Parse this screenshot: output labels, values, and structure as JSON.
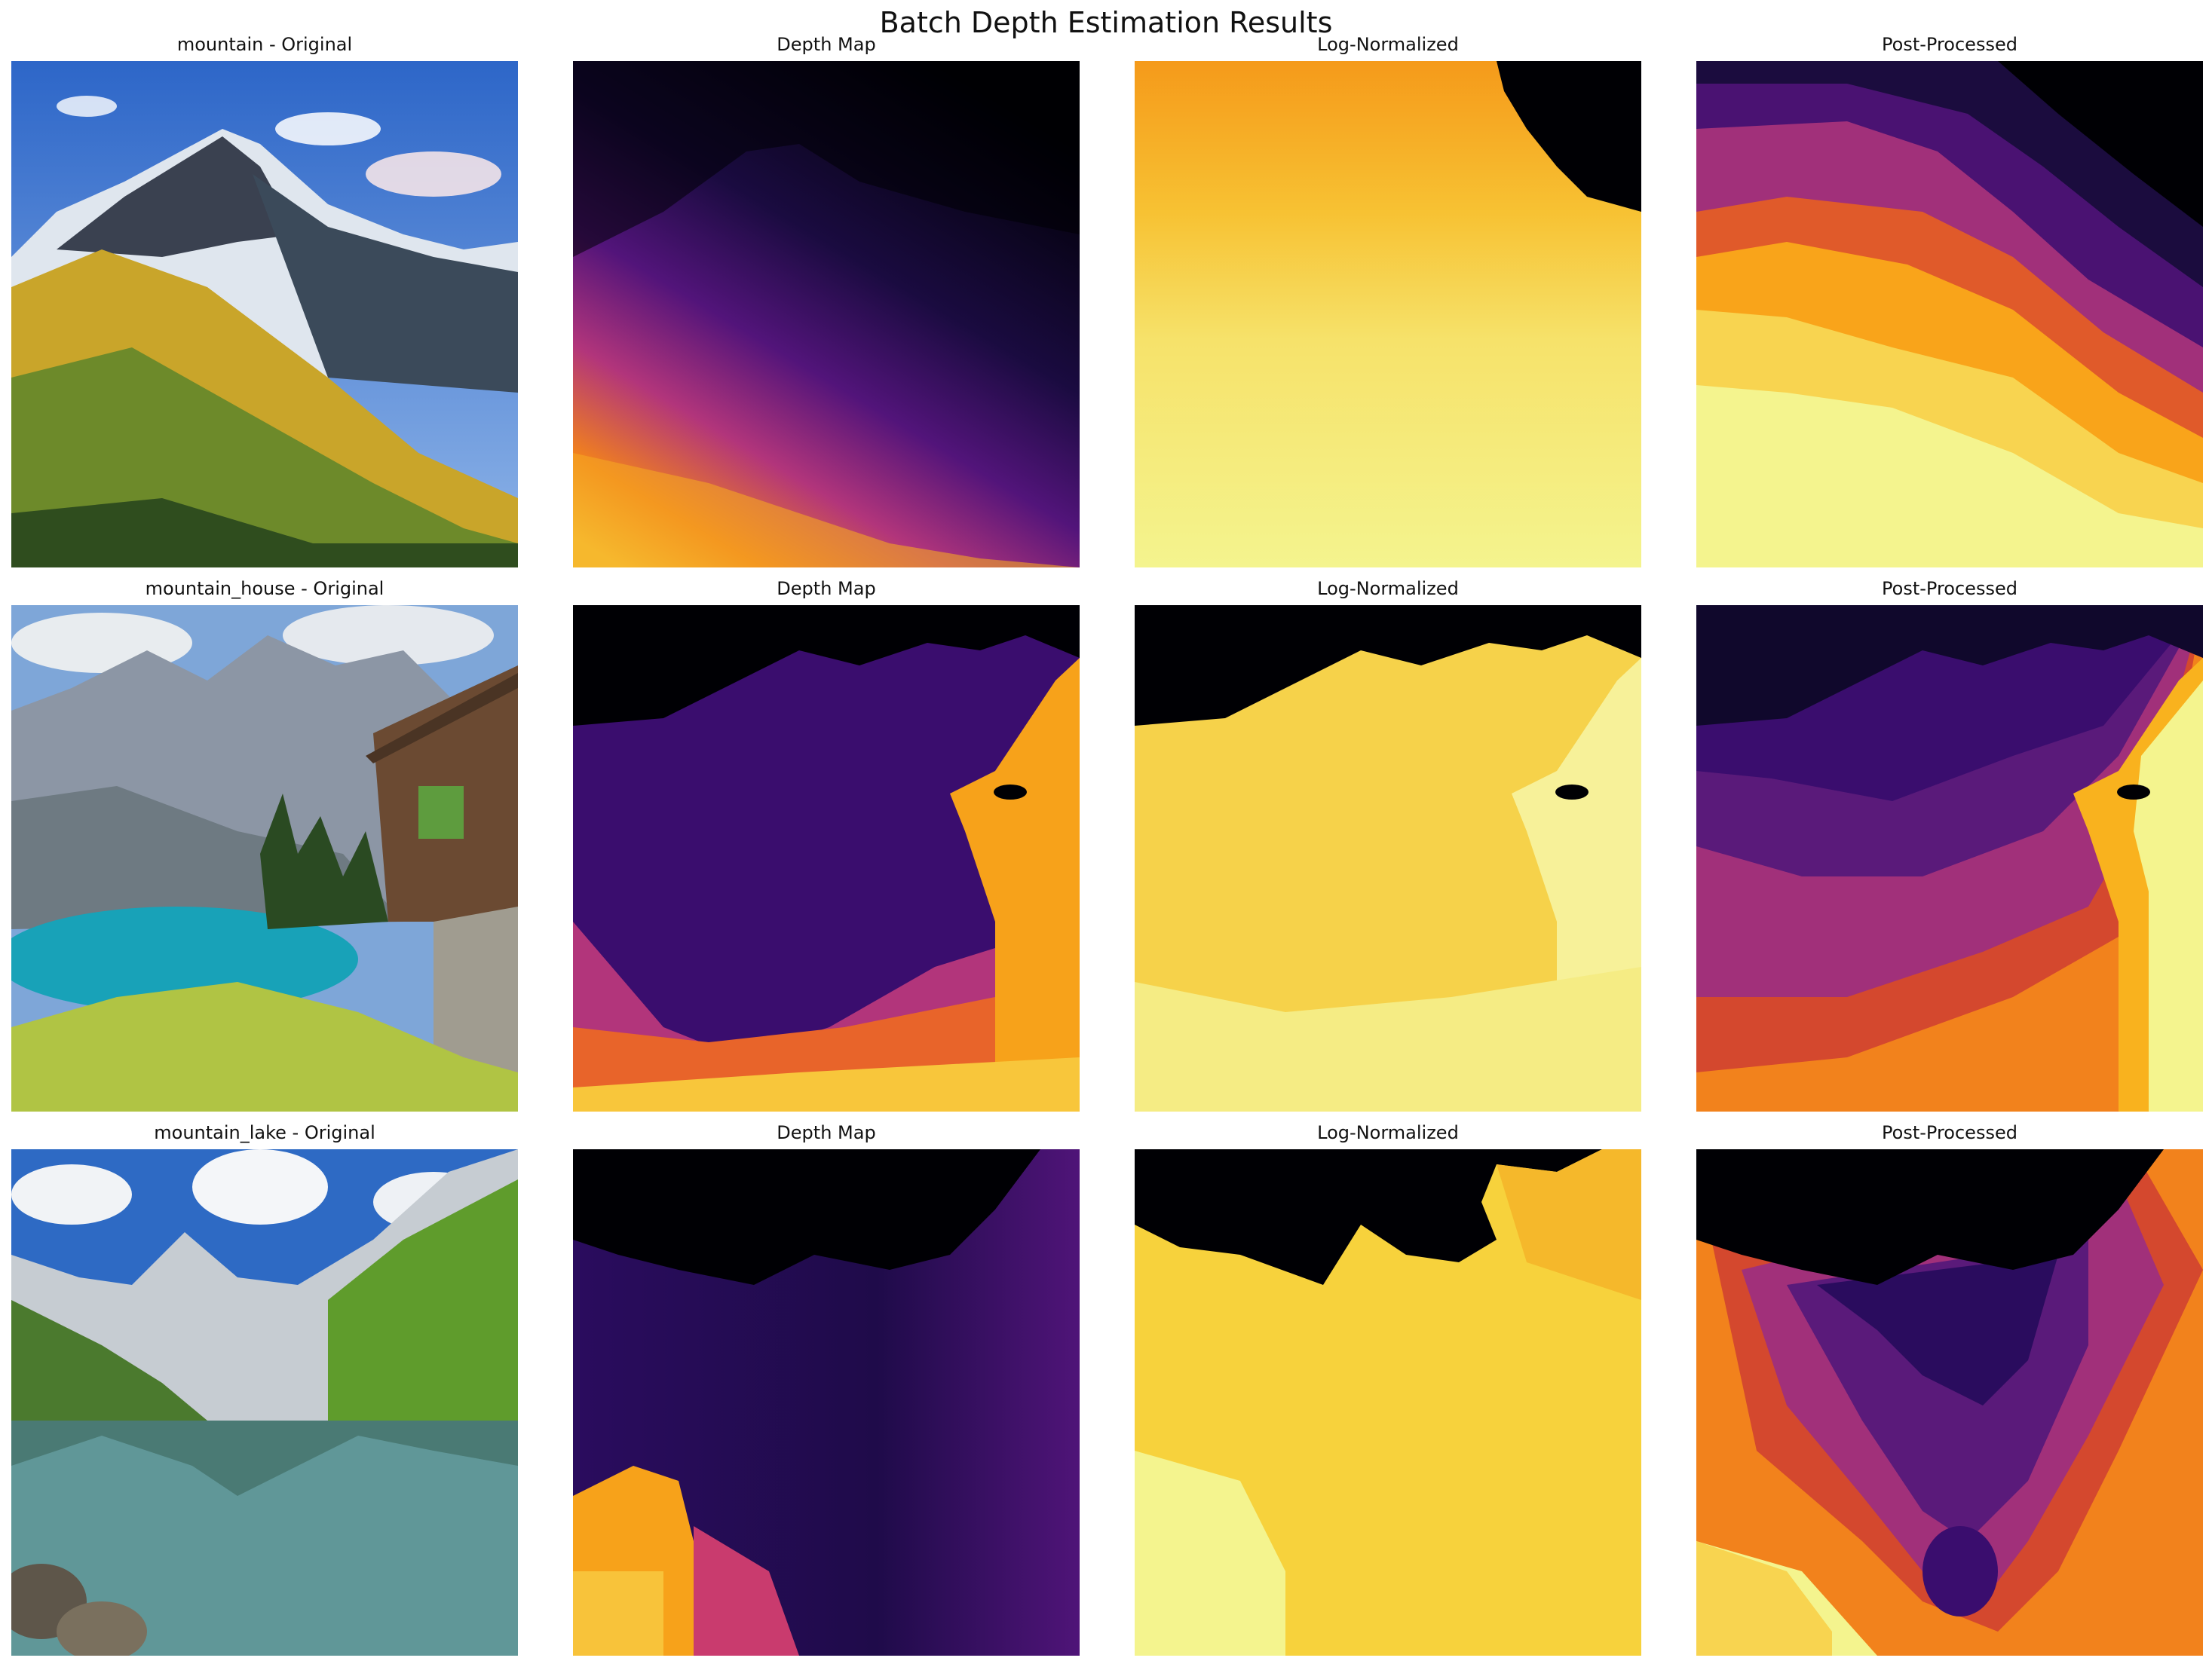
{
  "figure": {
    "title": "Batch Depth Estimation Results"
  },
  "rows": [
    {
      "name": "mountain",
      "titles": [
        "mountain - Original",
        "Depth Map",
        "Log-Normalized",
        "Post-Processed"
      ]
    },
    {
      "name": "mountain_house",
      "titles": [
        "mountain_house - Original",
        "Depth Map",
        "Log-Normalized",
        "Post-Processed"
      ]
    },
    {
      "name": "mountain_lake",
      "titles": [
        "mountain_lake - Original",
        "Depth Map",
        "Log-Normalized",
        "Post-Processed"
      ]
    }
  ],
  "colors": {
    "sky": "#5b8fd6",
    "black": "#000004",
    "deep_purple": "#2a0c5e",
    "purple": "#5a1a7a",
    "magenta": "#b2357b",
    "orange": "#f2821c",
    "amber": "#fbb51a",
    "yellow": "#f6e26a",
    "pale_yellow": "#f4f48e"
  }
}
